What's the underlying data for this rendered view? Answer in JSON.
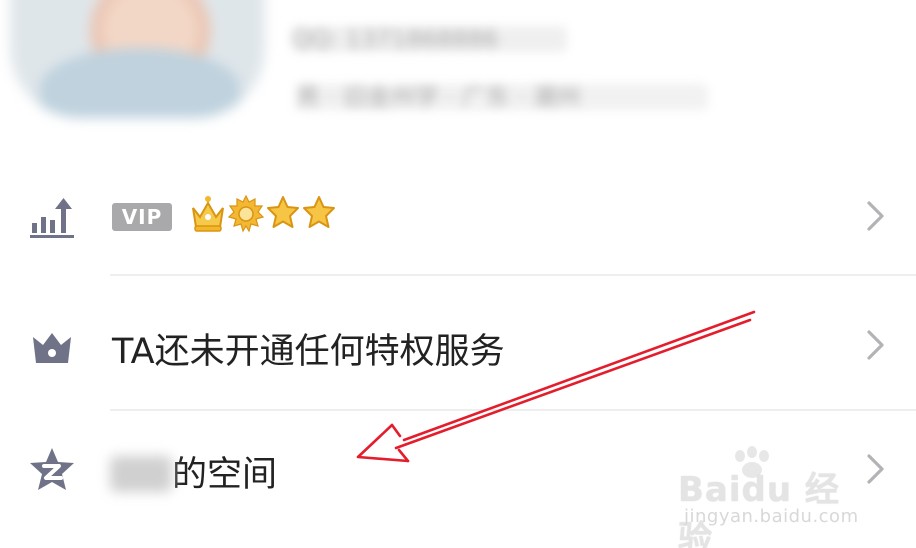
{
  "profile": {
    "qq_line": "QQ: 1371868886",
    "meta_line": "男 · 旧金州学 · 广东 · 潮州"
  },
  "vip_row": {
    "badge": "VIP",
    "level_icons": [
      "crown-icon",
      "sun-icon",
      "star-icon",
      "star-icon"
    ]
  },
  "privilege_row": {
    "label": "TA还未开通任何特权服务"
  },
  "space_row": {
    "label_suffix": "的空间"
  },
  "watermark": {
    "logo": "Baidu 经验",
    "site": "jingyan.baidu.com"
  },
  "colors": {
    "icon_gray": "#707287",
    "chevron_gray": "#b3b3b7",
    "divider": "#eeeeee",
    "annotation_red": "#e41d2c",
    "crown_gold": "#f4b72a"
  }
}
